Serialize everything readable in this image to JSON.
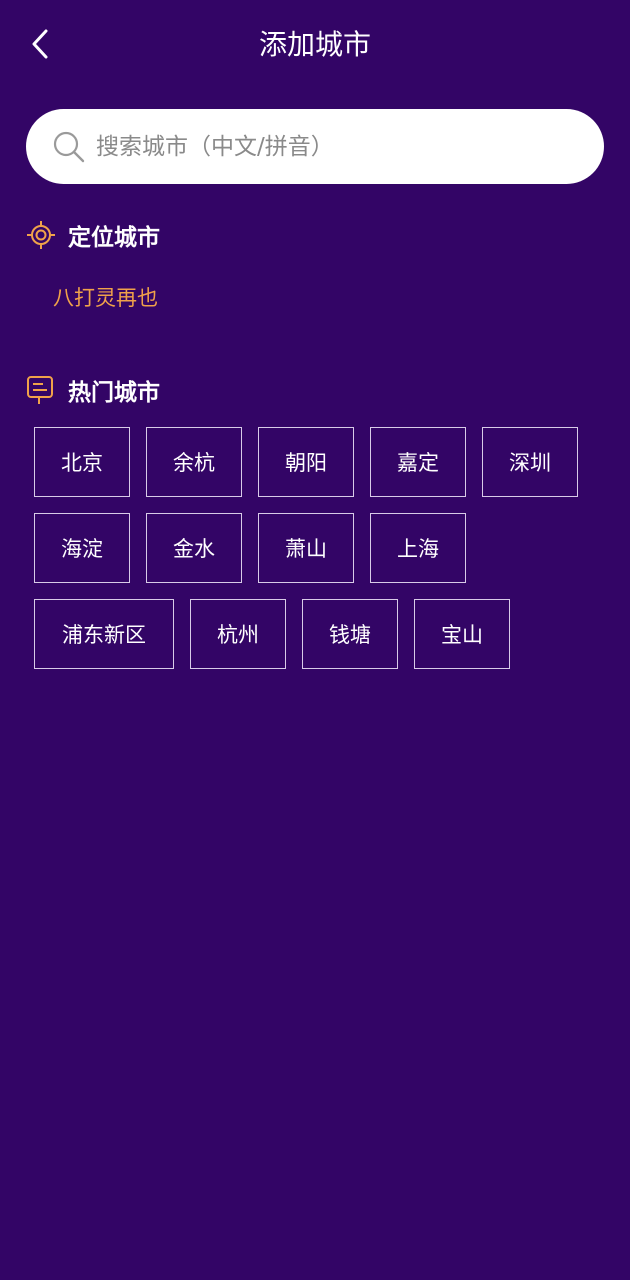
{
  "header": {
    "title": "添加城市",
    "back_icon": "chevron-left-icon"
  },
  "search": {
    "placeholder": "搜索城市（中文/拼音）",
    "value": "",
    "icon": "search-icon"
  },
  "location_section": {
    "title": "定位城市",
    "icon": "location-target-icon",
    "city": "八打灵再也"
  },
  "hot_section": {
    "title": "热门城市",
    "icon": "signpost-icon",
    "cities": [
      "北京",
      "余杭",
      "朝阳",
      "嘉定",
      "深圳",
      "海淀",
      "金水",
      "萧山",
      "上海",
      "浦东新区",
      "杭州",
      "钱塘",
      "宝山"
    ]
  },
  "colors": {
    "background": "#330566",
    "accent": "#f0a24a",
    "city_border": "#d8cbe8"
  }
}
